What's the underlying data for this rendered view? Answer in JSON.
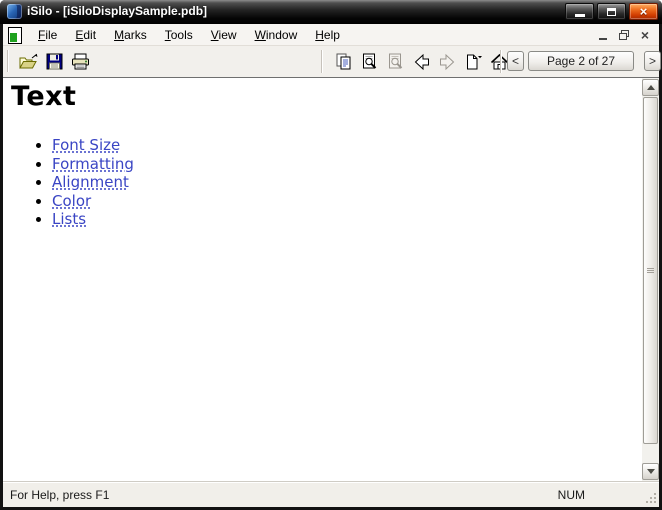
{
  "titlebar": {
    "title": "iSilo - [iSiloDisplaySample.pdb]"
  },
  "menubar": {
    "items": [
      {
        "label": "File"
      },
      {
        "label": "Edit"
      },
      {
        "label": "Marks"
      },
      {
        "label": "Tools"
      },
      {
        "label": "View"
      },
      {
        "label": "Window"
      },
      {
        "label": "Help"
      }
    ]
  },
  "toolbar": {
    "icon_names": "open, save, print, copy, find, find-disabled, back, forward-disabled, new-bookmark, home",
    "page_nav": {
      "prev_label": "<",
      "page_label": "Page 2 of 27",
      "next_label": ">"
    }
  },
  "content": {
    "heading": "Text",
    "links": [
      {
        "label": "Font Size"
      },
      {
        "label": "Formatting"
      },
      {
        "label": "Alignment"
      },
      {
        "label": "Color"
      },
      {
        "label": "Lists"
      }
    ]
  },
  "statusbar": {
    "message": "For Help, press F1",
    "num_indicator": "NUM"
  },
  "icons": {
    "window_close_glyph": "×",
    "mdi_close_glyph": "×"
  },
  "colors": {
    "titlebar_bg": "#000000",
    "close_button": "#d04000",
    "link": "#3a45c4",
    "chrome_bg": "#f2f0ec",
    "content_bg": "#ffffff"
  }
}
